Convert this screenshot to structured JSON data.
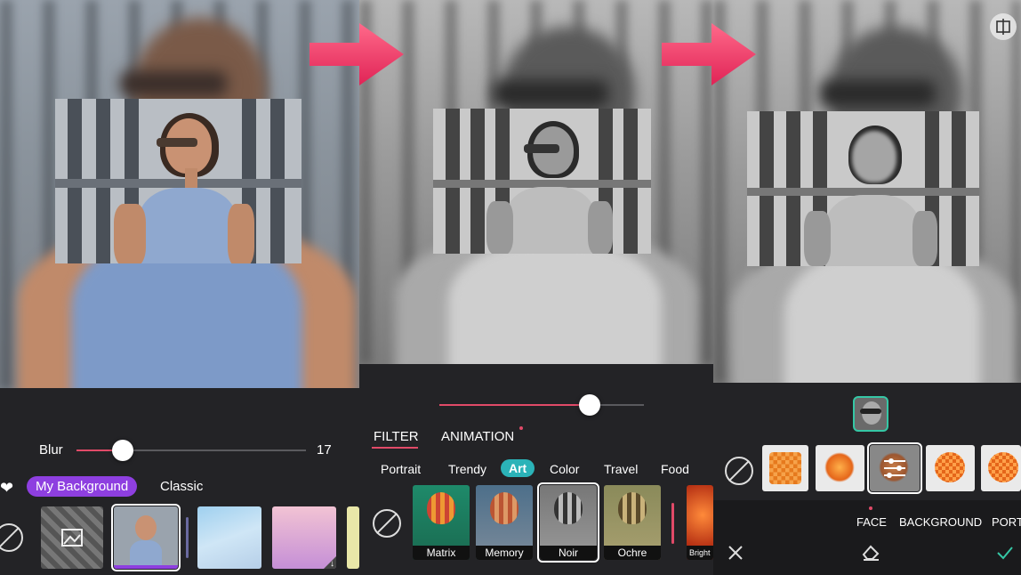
{
  "panel1": {
    "blur_label": "Blur",
    "blur_value": "17",
    "tabs": [
      {
        "label": "My Background",
        "active": true
      },
      {
        "label": "Classic",
        "active": false
      }
    ],
    "icons": [
      "heart-icon",
      "none-icon",
      "image-icon",
      "download-icon"
    ]
  },
  "panel2": {
    "modes": [
      {
        "label": "FILTER",
        "active": true
      },
      {
        "label": "ANIMATION",
        "active": false,
        "has_dot": true
      }
    ],
    "categories": [
      "Portrait",
      "Trendy",
      "Art",
      "Color",
      "Travel",
      "Food"
    ],
    "active_category": "Art",
    "filters": [
      {
        "name": "Matrix",
        "selected": false
      },
      {
        "name": "Memory",
        "selected": false
      },
      {
        "name": "Noir",
        "selected": true
      },
      {
        "name": "Ochre",
        "selected": false
      },
      {
        "name": "Bright",
        "selected": false
      }
    ]
  },
  "panel3": {
    "tabs": [
      "FACE",
      "BACKGROUND",
      "PORT"
    ],
    "active_tab": "FACE",
    "icons": [
      "compare-icon",
      "none-icon",
      "sliders-icon",
      "close-icon",
      "eraser-icon",
      "check-icon"
    ]
  },
  "colors": {
    "accent_pink": "#e14a68",
    "accent_purple": "#8e3fe0",
    "accent_teal": "#2bb3b8",
    "panel_dark": "#232326"
  }
}
